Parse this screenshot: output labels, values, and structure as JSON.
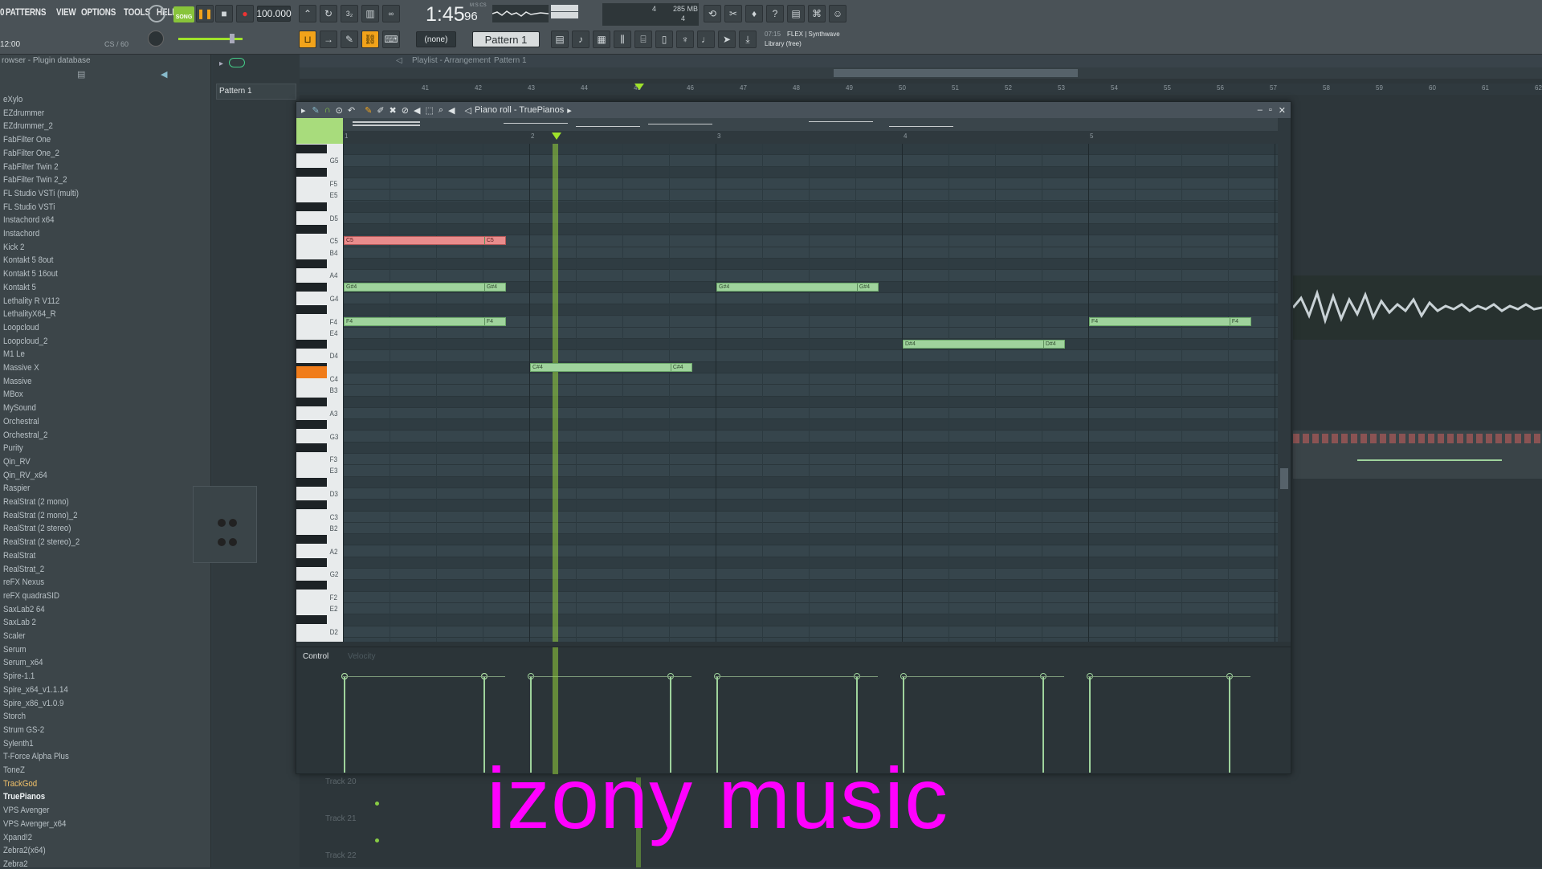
{
  "menu": [
    "0",
    "PATTERNS",
    "VIEW",
    "OPTIONS",
    "TOOLS",
    "HELP"
  ],
  "transport": {
    "mode": "SONG",
    "tempo": "100.000",
    "time": "1:45",
    "time_sub": "96",
    "mics": "M:S:CS",
    "cpu": "4",
    "mem": "285 MB",
    "poly": "4",
    "hint_time": "12:00",
    "hint_pos": "CS / 60"
  },
  "toolbar2": {
    "snap": "(none)",
    "pattern": "Pattern 1",
    "news_time": "07:15",
    "news_title": "FLEX | Synthwave",
    "news_sub": "Library (free)"
  },
  "browser": {
    "breadcrumb": "rowser - Plugin database",
    "items": [
      "eXylo",
      "EZdrummer",
      "EZdrummer_2",
      "FabFilter One",
      "FabFilter One_2",
      "FabFilter Twin 2",
      "FabFilter Twin 2_2",
      "FL Studio VSTi (multi)",
      "FL Studio VSTi",
      "Instachord x64",
      "Instachord",
      "Kick 2",
      "Kontakt 5 8out",
      "Kontakt 5 16out",
      "Kontakt 5",
      "Lethality R V112",
      "LethalityX64_R",
      "Loopcloud",
      "Loopcloud_2",
      "M1 Le",
      "Massive X",
      "Massive",
      "MBox",
      "MySound",
      "Orchestral",
      "Orchestral_2",
      "Purity",
      "Qin_RV",
      "Qin_RV_x64",
      "Raspier",
      "RealStrat (2 mono)",
      "RealStrat (2 mono)_2",
      "RealStrat (2 stereo)",
      "RealStrat (2 stereo)_2",
      "RealStrat",
      "RealStrat_2",
      "reFX Nexus",
      "reFX quadraSID",
      "SaxLab2 64",
      "SaxLab 2",
      "Scaler",
      "Serum",
      "Serum_x64",
      "Spire-1.1",
      "Spire_x64_v1.1.14",
      "Spire_x86_v1.0.9",
      "Storch",
      "Strum GS-2",
      "Sylenth1",
      "T-Force Alpha Plus",
      "ToneZ",
      "TrackGod",
      "TruePianos",
      "VPS Avenger",
      "VPS Avenger_x64",
      "Xpand!2",
      "Zebra2(x64)",
      "Zebra2"
    ],
    "selected": "TrackGod",
    "active": "TruePianos"
  },
  "channel": {
    "pattern_label": "Pattern 1"
  },
  "playlist": {
    "breadcrumb": "Playlist - Arrangement",
    "pattern_crumb": "Pattern 1",
    "bars": [
      "41",
      "42",
      "43",
      "44",
      "45",
      "46",
      "47",
      "48",
      "49",
      "50",
      "51",
      "52",
      "53",
      "54",
      "55",
      "56",
      "57",
      "58",
      "59",
      "60",
      "61",
      "62"
    ],
    "tracks": [
      "Track 20",
      "Track 21",
      "Track 22"
    ]
  },
  "piano_roll": {
    "title": "Piano roll - TruePianos",
    "bars": [
      "1",
      "2",
      "3",
      "4",
      "5"
    ],
    "key_labels": [
      "G5",
      "F5",
      "E5",
      "D5",
      "C5",
      "B4",
      "A4",
      "G4",
      "F4",
      "E4",
      "D4",
      "C4",
      "B3",
      "A3",
      "G3",
      "F3",
      "E3",
      "D3",
      "C3",
      "B2",
      "A2",
      "G2",
      "F2",
      "E2",
      "D2"
    ],
    "notes": [
      {
        "label": "C5",
        "tail": "C5",
        "color": "red"
      },
      {
        "label": "G#4",
        "tail": "G#4",
        "color": "green"
      },
      {
        "label": "F4",
        "tail": "F4",
        "color": "green"
      },
      {
        "label": "C#4",
        "tail": "C#4",
        "color": "green"
      },
      {
        "label": "G#4",
        "tail": "G#4",
        "color": "green"
      },
      {
        "label": "D#4",
        "tail": "D#4",
        "color": "green"
      },
      {
        "label": "F4",
        "tail": "F4",
        "color": "green"
      }
    ],
    "control_label": "Control",
    "control_target": "Velocity"
  },
  "watermark": "izony music"
}
